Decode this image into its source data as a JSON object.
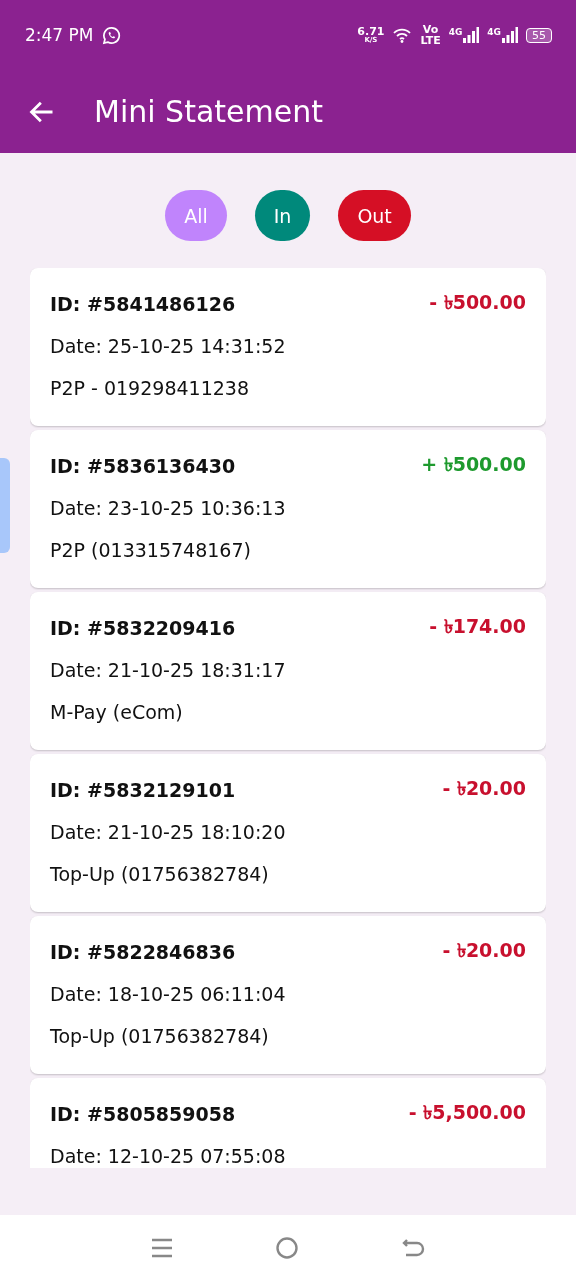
{
  "status_bar": {
    "time": "2:47 PM",
    "speed": "6.71",
    "speed_unit": "K/S",
    "volte_top": "Vo",
    "volte_bottom": "LTE",
    "sim1": "4G",
    "sim2": "4G",
    "battery": "55"
  },
  "header": {
    "title": "Mini Statement"
  },
  "filters": [
    {
      "label": "All",
      "color": "#c084fc"
    },
    {
      "label": "In",
      "color": "#00897b"
    },
    {
      "label": "Out",
      "color": "#d50f25"
    }
  ],
  "transactions": [
    {
      "id": "ID: #5841486126",
      "amount": "- ৳500.00",
      "kind": "out",
      "date": "Date: 25-10-25 14:31:52",
      "detail": "P2P - 019298411238"
    },
    {
      "id": "ID: #5836136430",
      "amount": "+ ৳500.00",
      "kind": "in",
      "date": "Date: 23-10-25 10:36:13",
      "detail": "P2P (013315748167)"
    },
    {
      "id": "ID: #5832209416",
      "amount": "- ৳174.00",
      "kind": "out",
      "date": "Date: 21-10-25 18:31:17",
      "detail": "M-Pay (eCom)"
    },
    {
      "id": "ID: #5832129101",
      "amount": "- ৳20.00",
      "kind": "out",
      "date": "Date: 21-10-25 18:10:20",
      "detail": "Top-Up (01756382784)"
    },
    {
      "id": "ID: #5822846836",
      "amount": "- ৳20.00",
      "kind": "out",
      "date": "Date: 18-10-25 06:11:04",
      "detail": "Top-Up (01756382784)"
    },
    {
      "id": "ID: #5805859058",
      "amount": "- ৳5,500.00",
      "kind": "out",
      "date": "Date: 12-10-25 07:55:08"
    }
  ]
}
